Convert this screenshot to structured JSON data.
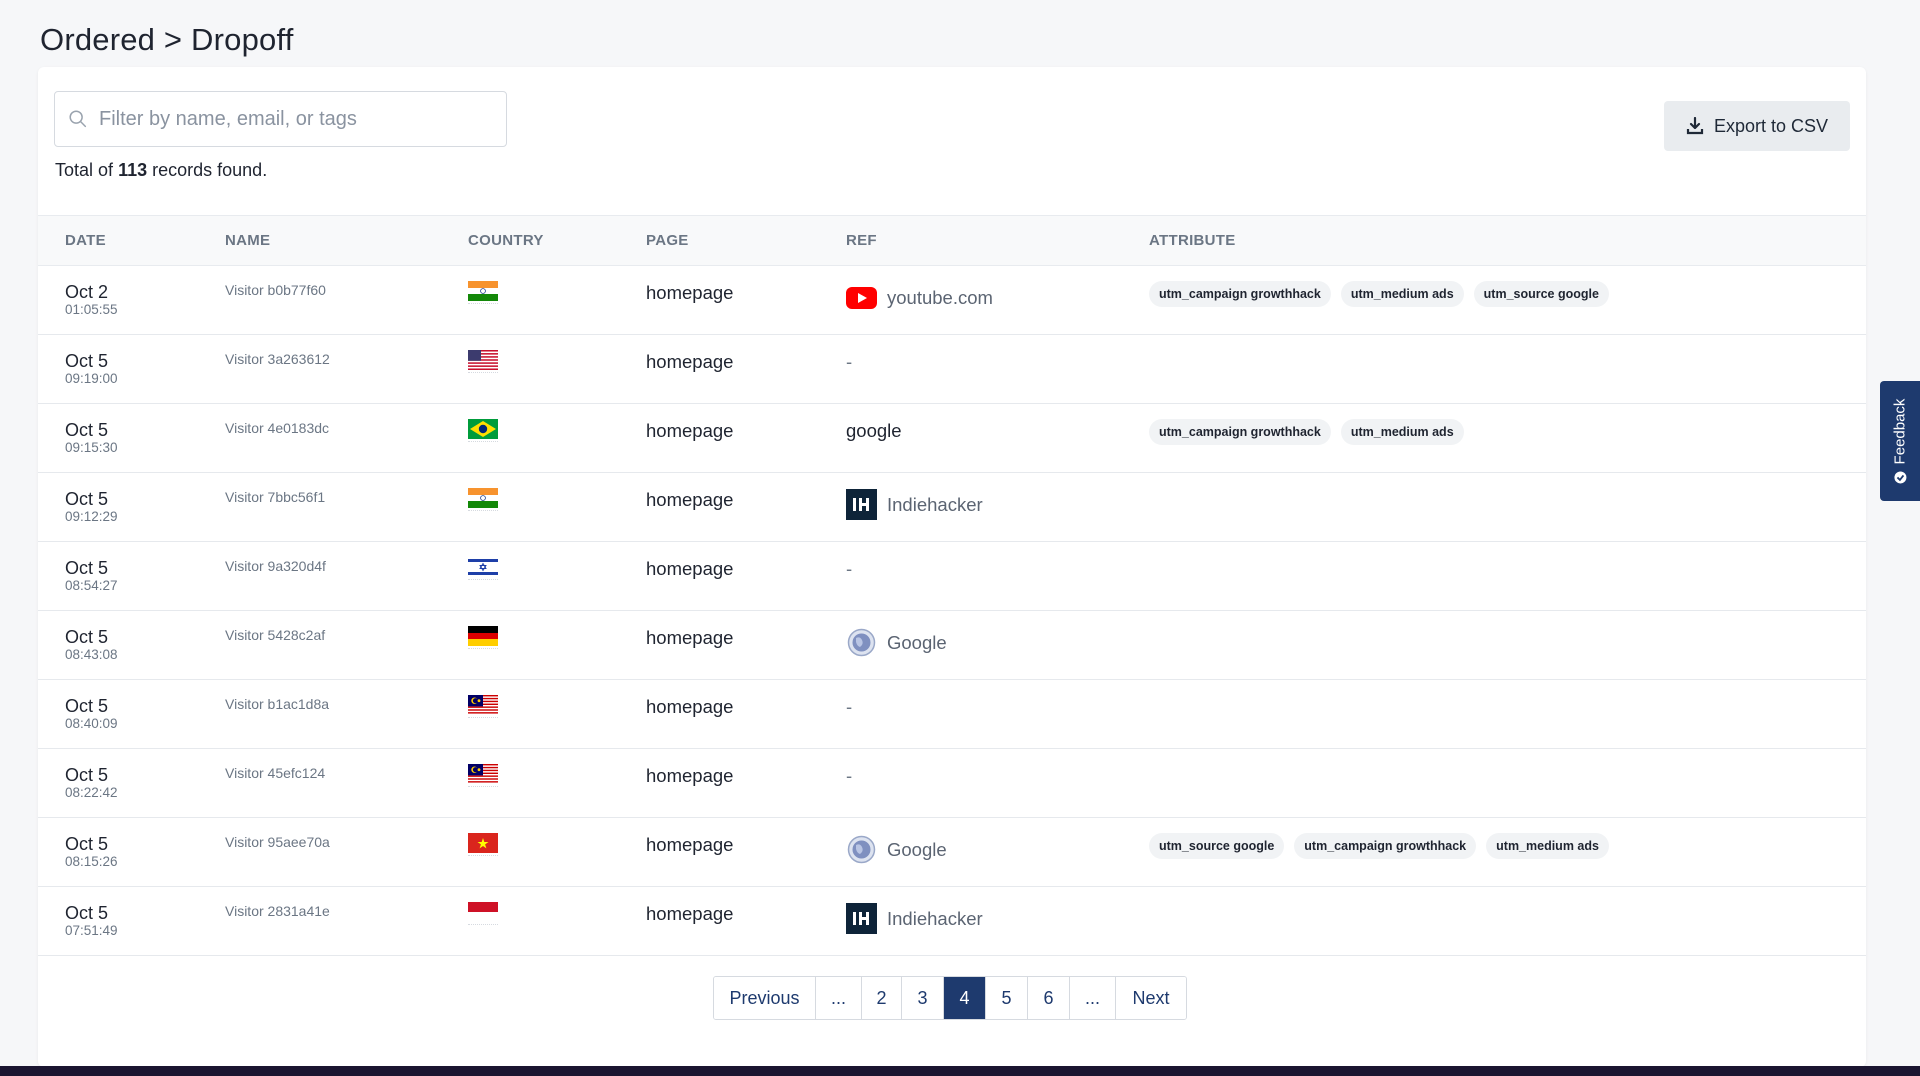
{
  "page": {
    "title": "Ordered > Dropoff"
  },
  "search": {
    "placeholder": "Filter by name, email, or tags",
    "value": ""
  },
  "toolbar": {
    "export_label": "Export to CSV"
  },
  "summary": {
    "prefix": "Total of",
    "count": "113",
    "suffix": "records found."
  },
  "columns": [
    "DATE",
    "NAME",
    "COUNTRY",
    "PAGE",
    "REF",
    "ATTRIBUTE"
  ],
  "rows": [
    {
      "date": "Oct 2",
      "time": "01:05:55",
      "name": "Visitor b0b77f60",
      "flag": "india",
      "page": "homepage",
      "ref": {
        "text": "youtube.com",
        "icon": "youtube-icon"
      },
      "tags": [
        "utm_campaign growthhack",
        "utm_medium ads",
        "utm_source google"
      ]
    },
    {
      "date": "Oct 5",
      "time": "09:19:00",
      "name": "Visitor 3a263612",
      "flag": "usa",
      "page": "homepage",
      "ref": {
        "text": "-",
        "icon": ""
      },
      "tags": []
    },
    {
      "date": "Oct 5",
      "time": "09:15:30",
      "name": "Visitor 4e0183dc",
      "flag": "brazil",
      "page": "homepage",
      "ref": {
        "text": "google",
        "icon": ""
      },
      "tags": [
        "utm_campaign growthhack",
        "utm_medium ads"
      ]
    },
    {
      "date": "Oct 5",
      "time": "09:12:29",
      "name": "Visitor 7bbc56f1",
      "flag": "india",
      "page": "homepage",
      "ref": {
        "text": "Indiehacker",
        "icon": "indiehacker-icon"
      },
      "tags": []
    },
    {
      "date": "Oct 5",
      "time": "08:54:27",
      "name": "Visitor 9a320d4f",
      "flag": "israel",
      "page": "homepage",
      "ref": {
        "text": "-",
        "icon": ""
      },
      "tags": []
    },
    {
      "date": "Oct 5",
      "time": "08:43:08",
      "name": "Visitor 5428c2af",
      "flag": "germany",
      "page": "homepage",
      "ref": {
        "text": "Google",
        "icon": "globe-icon"
      },
      "tags": []
    },
    {
      "date": "Oct 5",
      "time": "08:40:09",
      "name": "Visitor b1ac1d8a",
      "flag": "malaysia",
      "page": "homepage",
      "ref": {
        "text": "-",
        "icon": ""
      },
      "tags": []
    },
    {
      "date": "Oct 5",
      "time": "08:22:42",
      "name": "Visitor 45efc124",
      "flag": "malaysia",
      "page": "homepage",
      "ref": {
        "text": "-",
        "icon": ""
      },
      "tags": []
    },
    {
      "date": "Oct 5",
      "time": "08:15:26",
      "name": "Visitor 95aee70a",
      "flag": "vietnam",
      "page": "homepage",
      "ref": {
        "text": "Google",
        "icon": "globe-icon"
      },
      "tags": [
        "utm_source google",
        "utm_campaign growthhack",
        "utm_medium ads"
      ]
    },
    {
      "date": "Oct 5",
      "time": "07:51:49",
      "name": "Visitor 2831a41e",
      "flag": "indonesia",
      "page": "homepage",
      "ref": {
        "text": "Indiehacker",
        "icon": "indiehacker-icon"
      },
      "tags": []
    }
  ],
  "pagination": {
    "items": [
      {
        "label": "Previous",
        "active": false
      },
      {
        "label": "...",
        "active": false
      },
      {
        "label": "2",
        "active": false
      },
      {
        "label": "3",
        "active": false
      },
      {
        "label": "4",
        "active": true
      },
      {
        "label": "5",
        "active": false
      },
      {
        "label": "6",
        "active": false
      },
      {
        "label": "...",
        "active": false
      },
      {
        "label": "Next",
        "active": false
      }
    ]
  },
  "feedback": {
    "label": "Feedback"
  },
  "colors": {
    "accent": "#1e3a6e",
    "tag_bg": "#f1f3f5"
  }
}
